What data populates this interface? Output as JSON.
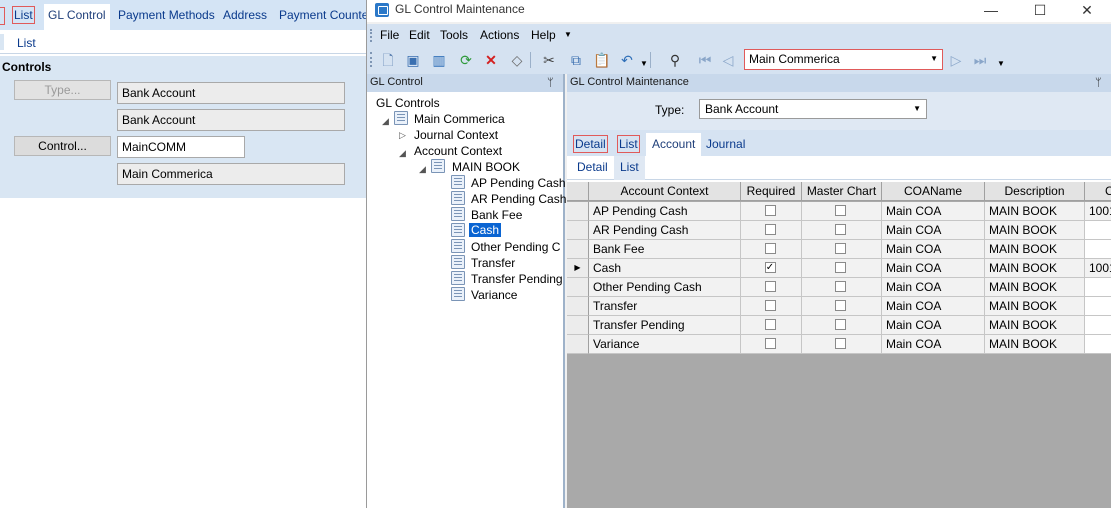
{
  "bg_window": {
    "tabs": [
      "List",
      "GL Control",
      "Payment Methods",
      "Address",
      "Payment Counte"
    ],
    "sub_tab": "List",
    "section_title": "Controls",
    "type_button": "Type...",
    "type_value": "Bank Account",
    "type_desc": "Bank Account",
    "control_button": "Control...",
    "control_value": "MainCOMM",
    "control_desc": "Main Commerica"
  },
  "window": {
    "title": "GL Control Maintenance",
    "minimize": "—",
    "maximize": "☐",
    "close": "✕"
  },
  "menu": [
    "File",
    "Edit",
    "Tools",
    "Actions",
    "Help"
  ],
  "toolbar": {
    "combo_value": "Main Commerica"
  },
  "left_pane": {
    "title": "GL Control",
    "pin": "ᛘ",
    "tree": {
      "root": "GL Controls",
      "company": "Main Commerica",
      "journal": "Journal Context",
      "account": "Account Context",
      "book": "MAIN BOOK",
      "items": [
        "AP Pending Cash",
        "AR Pending Cash",
        "Bank Fee",
        "Cash",
        "Other Pending C",
        "Transfer",
        "Transfer Pending",
        "Variance"
      ],
      "selected": "Cash"
    }
  },
  "right_pane": {
    "title": "GL Control Maintenance",
    "pin": "ᛘ",
    "type_label": "Type:",
    "type_value": "Bank Account",
    "tabs": [
      "Detail",
      "List",
      "Account",
      "Journal"
    ],
    "subtabs": [
      "Detail",
      "List"
    ],
    "columns": [
      "Account Context",
      "Required",
      "Master Chart",
      "COAName",
      "Description",
      "C"
    ],
    "rows": [
      {
        "context": "AP Pending Cash",
        "required": false,
        "master": false,
        "coa": "Main COA",
        "desc": "MAIN BOOK",
        "c": "1001"
      },
      {
        "context": "AR Pending Cash",
        "required": false,
        "master": false,
        "coa": "Main COA",
        "desc": "MAIN BOOK",
        "c": ""
      },
      {
        "context": "Bank Fee",
        "required": false,
        "master": false,
        "coa": "Main COA",
        "desc": "MAIN BOOK",
        "c": ""
      },
      {
        "context": "Cash",
        "required": true,
        "master": false,
        "coa": "Main COA",
        "desc": "MAIN BOOK",
        "c": "1001"
      },
      {
        "context": "Other Pending Cash",
        "required": false,
        "master": false,
        "coa": "Main COA",
        "desc": "MAIN BOOK",
        "c": ""
      },
      {
        "context": "Transfer",
        "required": false,
        "master": false,
        "coa": "Main COA",
        "desc": "MAIN BOOK",
        "c": ""
      },
      {
        "context": "Transfer Pending",
        "required": false,
        "master": false,
        "coa": "Main COA",
        "desc": "MAIN BOOK",
        "c": ""
      },
      {
        "context": "Variance",
        "required": false,
        "master": false,
        "coa": "Main COA",
        "desc": "MAIN BOOK",
        "c": ""
      }
    ],
    "current_row_marker": "▶"
  },
  "colors": {
    "accent_red_outline": "#e05a5a",
    "pane_header": "#c8d8eb",
    "selection_blue": "#0a64d2"
  }
}
